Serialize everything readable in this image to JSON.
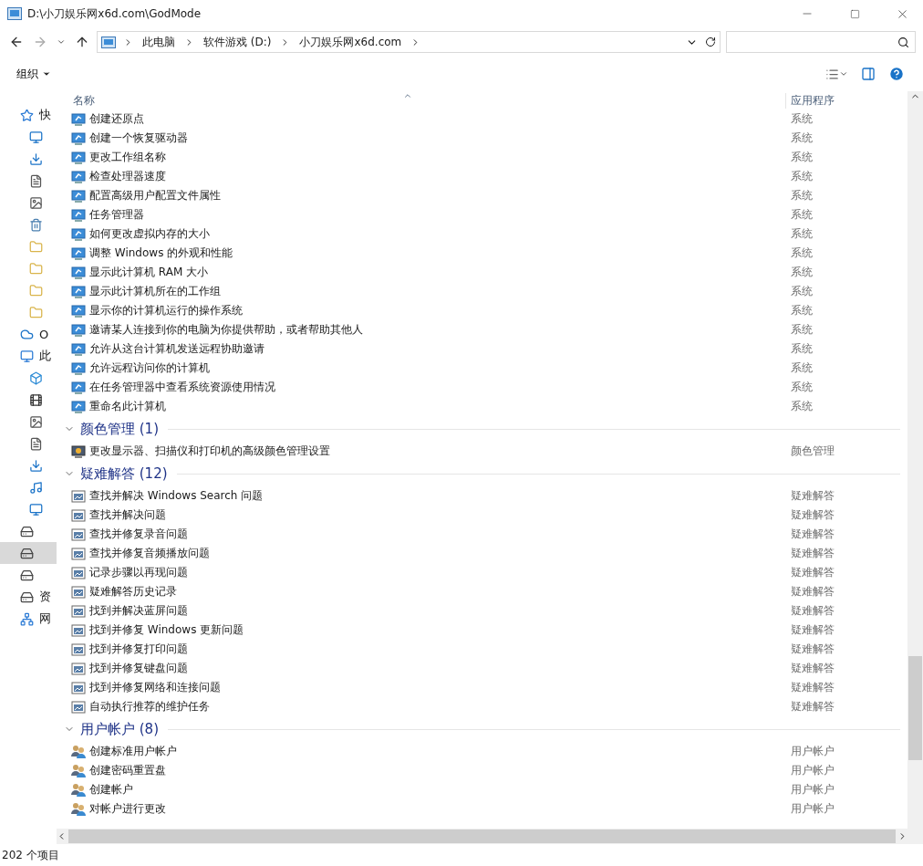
{
  "window": {
    "title": "D:\\小刀娱乐网x6d.com\\GodMode"
  },
  "address_bar": {
    "crumbs": [
      "此电脑",
      "软件游戏 (D:)",
      "小刀娱乐网x6d.com"
    ]
  },
  "toolbar": {
    "organize": "组织"
  },
  "nav_pane": {
    "items": [
      {
        "kind": "star",
        "label": "快",
        "selected": false
      },
      {
        "kind": "desktop",
        "selected": false
      },
      {
        "kind": "download",
        "selected": false
      },
      {
        "kind": "document",
        "selected": false
      },
      {
        "kind": "image",
        "selected": false
      },
      {
        "kind": "recycle",
        "selected": false
      },
      {
        "kind": "folder",
        "selected": false
      },
      {
        "kind": "folder",
        "selected": false
      },
      {
        "kind": "folder",
        "selected": false
      },
      {
        "kind": "folder",
        "selected": false
      },
      {
        "kind": "cloud",
        "label": "O",
        "selected": false
      },
      {
        "kind": "pc",
        "label": "此",
        "selected": false
      },
      {
        "kind": "cube",
        "selected": false
      },
      {
        "kind": "film",
        "selected": false
      },
      {
        "kind": "image",
        "selected": false
      },
      {
        "kind": "document",
        "selected": false
      },
      {
        "kind": "download",
        "selected": false
      },
      {
        "kind": "music",
        "selected": false
      },
      {
        "kind": "desktop",
        "selected": false
      },
      {
        "kind": "drive",
        "selected": false
      },
      {
        "kind": "drive",
        "selected": true
      },
      {
        "kind": "drive",
        "selected": false
      },
      {
        "kind": "drive",
        "label": "资",
        "selected": false
      },
      {
        "kind": "network",
        "label": "网",
        "selected": false
      }
    ]
  },
  "columns": [
    "名称",
    "应用程序"
  ],
  "groups": [
    {
      "kind": "system",
      "items": [
        {
          "name": "创建还原点",
          "app": "系统"
        },
        {
          "name": "创建一个恢复驱动器",
          "app": "系统"
        },
        {
          "name": "更改工作组名称",
          "app": "系统"
        },
        {
          "name": "检查处理器速度",
          "app": "系统"
        },
        {
          "name": "配置高级用户配置文件属性",
          "app": "系统"
        },
        {
          "name": "任务管理器",
          "app": "系统"
        },
        {
          "name": "如何更改虚拟内存的大小",
          "app": "系统"
        },
        {
          "name": "调整 Windows 的外观和性能",
          "app": "系统"
        },
        {
          "name": "显示此计算机 RAM 大小",
          "app": "系统"
        },
        {
          "name": "显示此计算机所在的工作组",
          "app": "系统"
        },
        {
          "name": "显示你的计算机运行的操作系统",
          "app": "系统"
        },
        {
          "name": "邀请某人连接到你的电脑为你提供帮助，或者帮助其他人",
          "app": "系统"
        },
        {
          "name": "允许从这台计算机发送远程协助邀请",
          "app": "系统"
        },
        {
          "name": "允许远程访问你的计算机",
          "app": "系统"
        },
        {
          "name": "在任务管理器中查看系统资源使用情况",
          "app": "系统"
        },
        {
          "name": "重命名此计算机",
          "app": "系统"
        }
      ]
    },
    {
      "kind": "color",
      "title": "颜色管理 (1)",
      "expanded": true,
      "items": [
        {
          "name": "更改显示器、扫描仪和打印机的高级颜色管理设置",
          "app": "颜色管理"
        }
      ]
    },
    {
      "kind": "troubleshoot",
      "title": "疑难解答 (12)",
      "expanded": true,
      "items": [
        {
          "name": "查找并解决 Windows Search 问题",
          "app": "疑难解答"
        },
        {
          "name": "查找并解决问题",
          "app": "疑难解答"
        },
        {
          "name": "查找并修复录音问题",
          "app": "疑难解答"
        },
        {
          "name": "查找并修复音频播放问题",
          "app": "疑难解答"
        },
        {
          "name": "记录步骤以再现问题",
          "app": "疑难解答"
        },
        {
          "name": "疑难解答历史记录",
          "app": "疑难解答"
        },
        {
          "name": "找到并解决蓝屏问题",
          "app": "疑难解答"
        },
        {
          "name": "找到并修复 Windows 更新问题",
          "app": "疑难解答"
        },
        {
          "name": "找到并修复打印问题",
          "app": "疑难解答"
        },
        {
          "name": "找到并修复键盘问题",
          "app": "疑难解答"
        },
        {
          "name": "找到并修复网络和连接问题",
          "app": "疑难解答"
        },
        {
          "name": "自动执行推荐的维护任务",
          "app": "疑难解答"
        }
      ]
    },
    {
      "kind": "user",
      "title": "用户帐户 (8)",
      "expanded": true,
      "items": [
        {
          "name": "创建标准用户帐户",
          "app": "用户帐户"
        },
        {
          "name": "创建密码重置盘",
          "app": "用户帐户"
        },
        {
          "name": "创建帐户",
          "app": "用户帐户"
        },
        {
          "name": "对帐户进行更改",
          "app": "用户帐户"
        }
      ]
    }
  ],
  "status_bar": {
    "count": "202 个项目"
  }
}
